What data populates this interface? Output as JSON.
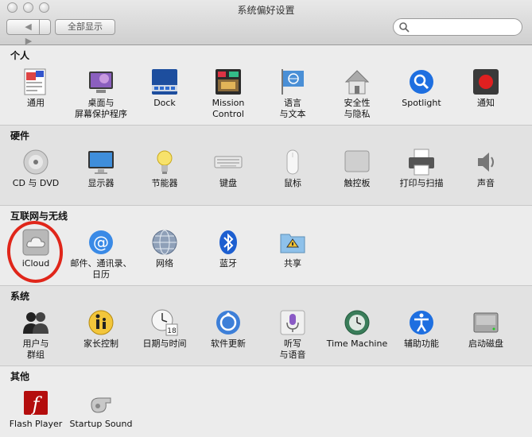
{
  "window": {
    "title": "系统偏好设置"
  },
  "toolbar": {
    "back_label": "◀",
    "forward_label": "▶",
    "show_all_label": "全部显示",
    "search_placeholder": ""
  },
  "sections": {
    "personal": {
      "label": "个人",
      "items": [
        "通用",
        "桌面与\n屏幕保护程序",
        "Dock",
        "Mission\nControl",
        "语言\n与文本",
        "安全性\n与隐私",
        "Spotlight",
        "通知"
      ]
    },
    "hardware": {
      "label": "硬件",
      "items": [
        "CD 与 DVD",
        "显示器",
        "节能器",
        "键盘",
        "鼠标",
        "触控板",
        "打印与扫描",
        "声音"
      ]
    },
    "internet": {
      "label": "互联网与无线",
      "items": [
        "iCloud",
        "邮件、通讯录、\n日历",
        "网络",
        "蓝牙",
        "共享"
      ]
    },
    "system": {
      "label": "系统",
      "items": [
        "用户与\n群组",
        "家长控制",
        "日期与时间",
        "软件更新",
        "听写\n与语音",
        "Time Machine",
        "辅助功能",
        "启动磁盘"
      ]
    },
    "other": {
      "label": "其他",
      "items": [
        "Flash Player",
        "Startup Sound"
      ]
    }
  },
  "colors": {
    "highlight_circle": "#e0261a"
  }
}
